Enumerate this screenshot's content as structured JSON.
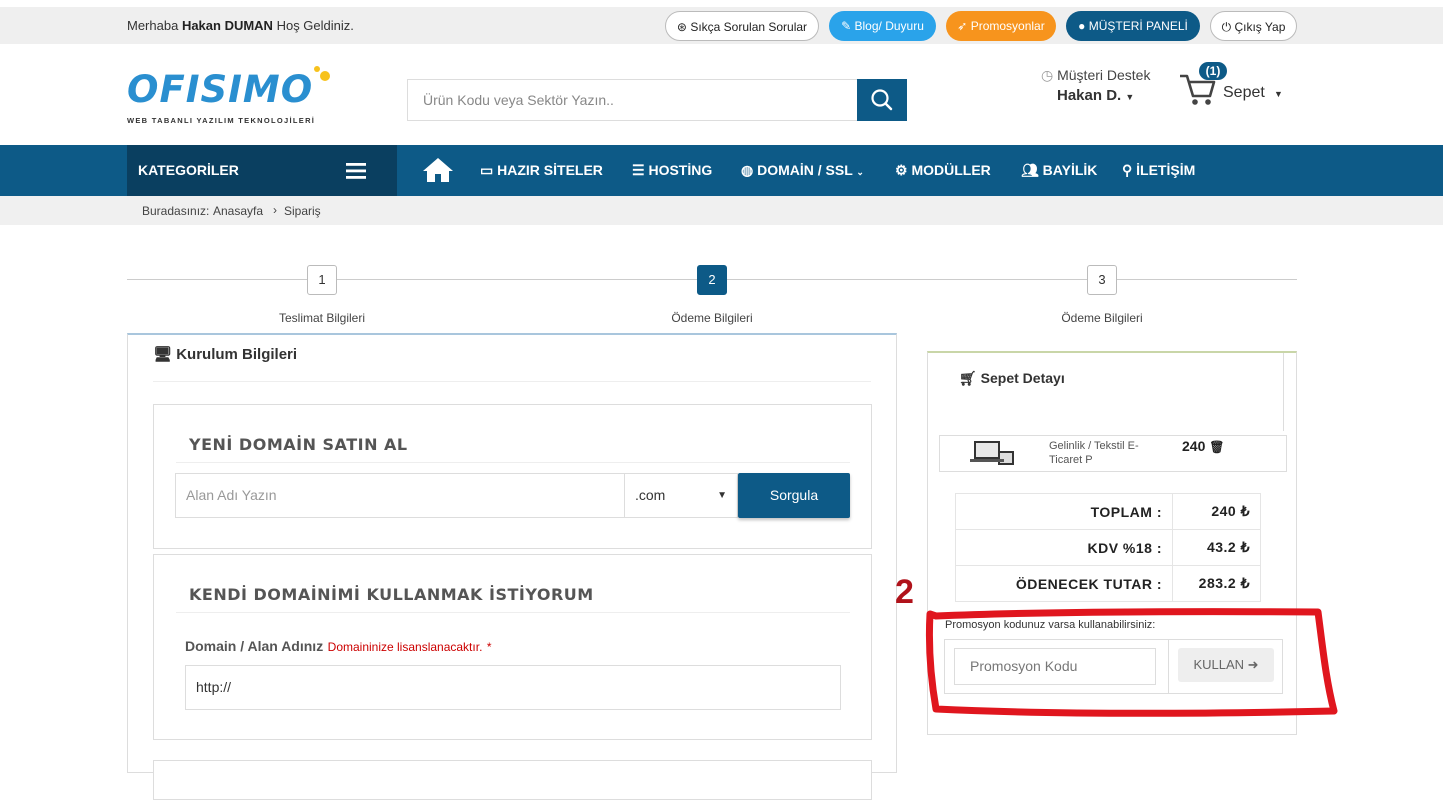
{
  "topbar": {
    "greeting_prefix": "Merhaba",
    "user_name": "Hakan DUMAN",
    "greeting_suffix": "Hoş Geldiniz.",
    "faq": "Sıkça Sorulan Sorular",
    "blog": "Blog/ Duyuru",
    "promo": "Promosyonlar",
    "panel": "MÜŞTERİ PANELİ",
    "logout": "Çıkış Yap"
  },
  "header": {
    "logo_text": "OFISIMO",
    "logo_tagline": "WEB TABANLI YAZILIM TEKNOLOJİLERİ",
    "search_placeholder": "Ürün Kodu veya Sektör Yazın..",
    "support_label": "Müşteri Destek",
    "support_user": "Hakan D.",
    "cart_count": "(1)",
    "cart_label": "Sepet"
  },
  "nav": {
    "category": "KATEGORİLER",
    "items": [
      "HAZIR SİTELER",
      "HOSTİNG",
      "DOMAİN / SSL",
      "MODÜLLER",
      "BAYİLİK",
      "İLETİŞİM"
    ]
  },
  "breadcrumb": {
    "label": "Buradasınız:",
    "home": "Anasayfa",
    "current": "Sipariş"
  },
  "steps": [
    {
      "num": "1",
      "label": "Teslimat Bilgileri"
    },
    {
      "num": "2",
      "label": "Ödeme Bilgileri"
    },
    {
      "num": "3",
      "label": "Ödeme Bilgileri"
    }
  ],
  "setup": {
    "title": "Kurulum Bilgileri",
    "new_domain_title": "YENİ DOMAİN SATIN AL",
    "domain_placeholder": "Alan Adı Yazın",
    "tld": ".com",
    "query_button": "Sorgula",
    "own_domain_title": "KENDİ DOMAİNİMİ KULLANMAK İSTİYORUM",
    "domain_label": "Domain / Alan Adınız",
    "domain_note": "Domaininize lisanslanacaktır.",
    "required_mark": "*",
    "domain_value": "http://"
  },
  "cart": {
    "title": "Sepet Detayı",
    "item_name": "Gelinlik / Tekstil E-Ticaret P",
    "item_price": "240",
    "totals": [
      {
        "label": "TOPLAM :",
        "value": "240 ₺"
      },
      {
        "label": "KDV %18 :",
        "value": "43.2 ₺"
      },
      {
        "label": "ÖDENECEK TUTAR :",
        "value": "283.2 ₺"
      }
    ],
    "promo_note": "Promosyon kodunuz varsa kullanabilirsiniz:",
    "promo_placeholder": "Promosyon Kodu",
    "promo_button": "KULLAN"
  },
  "annotation": {
    "number": "2",
    "color": "#e0161e"
  },
  "colors": {
    "primary": "#0d5a87",
    "dark_primary": "#0a3f60",
    "blog": "#2aa3ea",
    "promo": "#f7941d"
  }
}
